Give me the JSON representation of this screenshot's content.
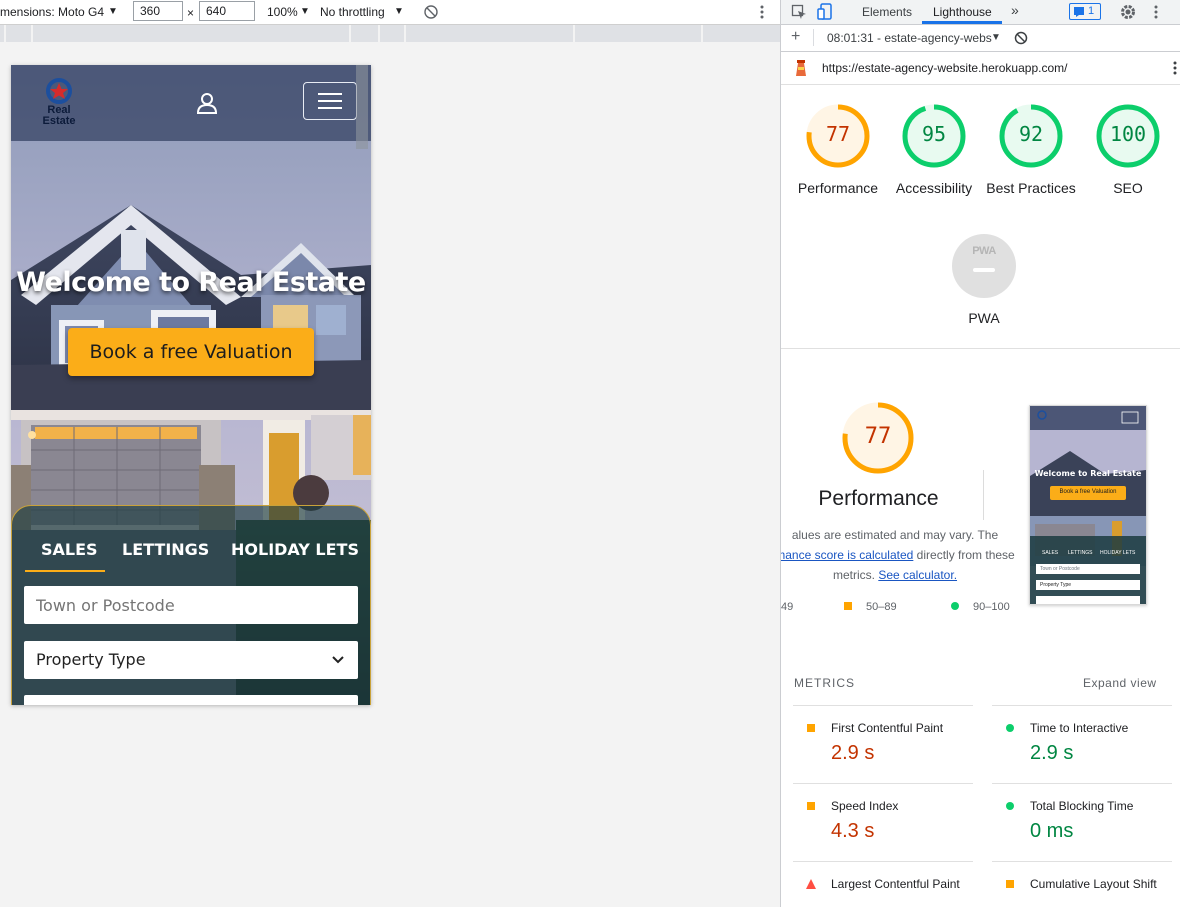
{
  "toolbar": {
    "dimensions_label": "mensions: Moto G4",
    "dropdown_caret": "▼",
    "width": "360",
    "times": "×",
    "height": "640",
    "zoom": "100%",
    "throttling": "No throttling"
  },
  "site": {
    "logo_line1": "Real",
    "logo_line2": "Estate",
    "hero_title": "Welcome to Real Estate",
    "cta_label": "Book a free Valuation",
    "tabs": [
      "SALES",
      "LETTINGS",
      "HOLIDAY LETS"
    ],
    "town_placeholder": "Town or Postcode",
    "property_type": "Property Type"
  },
  "devtools": {
    "tabs": {
      "elements": "Elements",
      "lighthouse": "Lighthouse",
      "more": "»",
      "issues_count": "1"
    },
    "report_selector": "08:01:31 - estate-agency-webs",
    "url": "https://estate-agency-website.herokuapp.com/",
    "add": "+"
  },
  "lighthouse": {
    "scores": [
      {
        "label": "Performance",
        "score": "77",
        "value": 77,
        "status": "orange"
      },
      {
        "label": "Accessibility",
        "score": "95",
        "value": 95,
        "status": "green"
      },
      {
        "label": "Best Practices",
        "score": "92",
        "value": 92,
        "status": "green"
      },
      {
        "label": "SEO",
        "score": "100",
        "value": 100,
        "status": "green"
      }
    ],
    "pwa": {
      "label": "PWA",
      "badge": "PWA"
    },
    "performance": {
      "score": "77",
      "title": "Performance",
      "desc_line1": "alues are estimated and may vary. The",
      "desc_link1": "mance score is calculated",
      "desc_line2_rest": " directly from these",
      "desc_line3": "metrics. ",
      "desc_link2": "See calculator."
    },
    "legend": [
      {
        "range": "49",
        "color": "#ff4e42"
      },
      {
        "range": "50–89",
        "color": "#ffa400"
      },
      {
        "range": "90–100",
        "color": "#0cce6b"
      }
    ],
    "thumbnail": {
      "hero_title": "Welcome to Real Estate",
      "cta_label": "Book a free Valuation",
      "tabs": [
        "SALES",
        "LETTINGS",
        "HOLIDAY LETS"
      ],
      "town_placeholder": "Town or Postcode",
      "property_type": "Property Type"
    },
    "metrics_title": "METRICS",
    "expand_view": "Expand view",
    "metrics": [
      {
        "label": "First Contentful Paint",
        "value": "2.9 s",
        "status": "orange"
      },
      {
        "label": "Time to Interactive",
        "value": "2.9 s",
        "status": "green"
      },
      {
        "label": "Speed Index",
        "value": "4.3 s",
        "status": "orange"
      },
      {
        "label": "Total Blocking Time",
        "value": "0 ms",
        "status": "green"
      },
      {
        "label": "Largest Contentful Paint",
        "value": "",
        "status": "red"
      },
      {
        "label": "Cumulative Layout Shift",
        "value": "",
        "status": "orange"
      }
    ],
    "colors": {
      "orange": "#ffa400",
      "green": "#0cce6b",
      "red": "#ff4e42",
      "orange_text": "#c33300",
      "green_text": "#018642",
      "cta": "#fbad18"
    }
  }
}
